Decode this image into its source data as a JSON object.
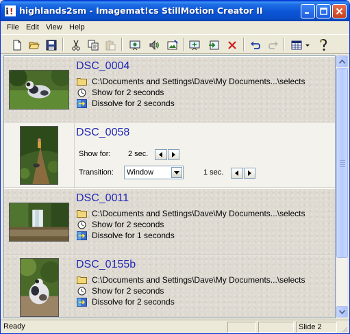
{
  "window": {
    "title": "highlands2sm - Imagemat!cs StillMotion Creator II",
    "controls": {
      "minimize": "minimize",
      "maximize": "maximize",
      "close": "close"
    }
  },
  "menu": [
    "File",
    "Edit",
    "View",
    "Help"
  ],
  "toolbar": {
    "buttons": [
      "new-icon",
      "open-icon",
      "save-icon",
      "cut-icon",
      "copy-icon",
      "paste-icon",
      "slide-properties-icon",
      "audio-icon",
      "image-edit-icon",
      "add-slide-icon",
      "import-icon",
      "delete-icon",
      "undo-icon",
      "redo-icon",
      "view-options-icon",
      "help-icon"
    ]
  },
  "slides": [
    {
      "name": "DSC_0004",
      "path": "C:\\Documents and Settings\\Dave\\My Documents...\\selects",
      "show": "Show for 2 seconds",
      "transition": "Dissolve for 2 seconds"
    },
    {
      "name": "DSC_0058",
      "editing": true,
      "show_label": "Show for:",
      "show_value": "2 sec.",
      "transition_label": "Transition:",
      "transition_value": "Window",
      "transition_duration": "1 sec."
    },
    {
      "name": "DSC_0011",
      "path": "C:\\Documents and Settings\\Dave\\My Documents...\\selects",
      "show": "Show for 2 seconds",
      "transition": "Dissolve for 1 seconds"
    },
    {
      "name": "DSC_0155b",
      "path": "C:\\Documents and Settings\\Dave\\My Documents...\\selects",
      "show": "Show for 2 seconds",
      "transition": "Dissolve for 2 seconds"
    }
  ],
  "status": {
    "left": "Ready",
    "right": "Slide 2"
  },
  "colors": {
    "title_blue": "#0a54d4",
    "slide_name": "#1f26b5",
    "panel": "#dedad1"
  }
}
